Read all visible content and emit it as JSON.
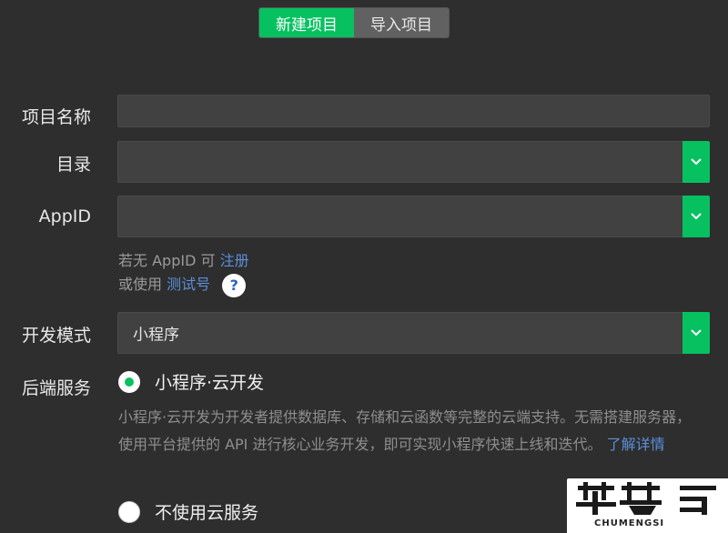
{
  "tabs": {
    "new_project": "新建项目",
    "import_project": "导入项目"
  },
  "form": {
    "project_name": {
      "label": "项目名称",
      "value": ""
    },
    "directory": {
      "label": "目录",
      "value": ""
    },
    "appid": {
      "label": "AppID",
      "value": ""
    },
    "appid_hint": {
      "prefix": "若无 AppID 可",
      "register_link": "注册"
    },
    "test_hint": {
      "prefix": "或使用",
      "test_link": "测试号",
      "help_icon": "?"
    },
    "dev_mode": {
      "label": "开发模式",
      "value": "小程序"
    },
    "backend": {
      "label": "后端服务",
      "option_cloud": "小程序·云开发",
      "cloud_desc": "小程序·云开发为开发者提供数据库、存储和云函数等完整的云端支持。无需搭建服务器，使用平台提供的 API 进行核心业务开发，即可实现小程序快速上线和迭代。",
      "learn_more": "了解详情",
      "option_none": "不使用云服务"
    }
  },
  "watermark": {
    "sub": "CHUMENGSI"
  },
  "colors": {
    "accent": "#07c160",
    "background": "#2e2e2e",
    "field": "#414141",
    "link": "#5b8fd9"
  }
}
